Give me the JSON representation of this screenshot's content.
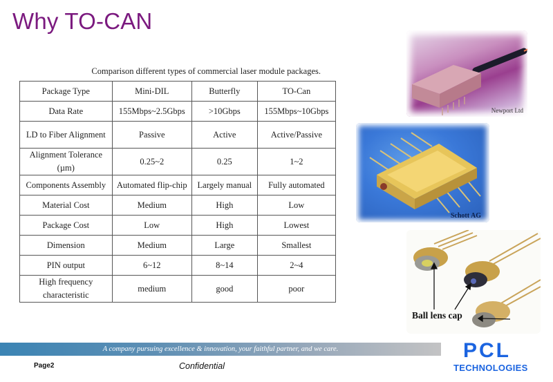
{
  "slide": {
    "title": "Why TO-CAN",
    "caption": "Comparison different types of commercial laser module packages."
  },
  "table": {
    "columns": [
      "Package Type",
      "Mini-DIL",
      "Butterfly",
      "TO-Can"
    ],
    "rows": [
      [
        "Data Rate",
        "155Mbps~2.5Gbps",
        ">10Gbps",
        "155Mbps~10Gbps"
      ],
      [
        "LD to Fiber Alignment",
        "Passive",
        "Active",
        "Active/Passive"
      ],
      [
        "Alignment Tolerance (µm)",
        "0.25~2",
        "0.25",
        "1~2"
      ],
      [
        "Components Assembly",
        "Automated flip-chip",
        "Largely manual",
        "Fully automated"
      ],
      [
        "Material Cost",
        "Medium",
        "High",
        "Low"
      ],
      [
        "Package Cost",
        "Low",
        "High",
        "Lowest"
      ],
      [
        "Dimension",
        "Medium",
        "Large",
        "Smallest"
      ],
      [
        "PIN output",
        "6~12",
        "8~14",
        "2~4"
      ],
      [
        "High frequency characteristic",
        "medium",
        "good",
        "poor"
      ]
    ]
  },
  "photos": [
    {
      "subject": "mini-dil-module",
      "credit": "Newport Ltd"
    },
    {
      "subject": "butterfly-package",
      "credit": "Schott AG"
    },
    {
      "subject": "to-can-packages",
      "annotation": "Ball lens cap"
    }
  ],
  "footer": {
    "tagline": "A company pursuing excellence  & innovation, your faithful partner, and we care.",
    "page": "Page2",
    "confidential": "Confidential",
    "logo_mark": "PCL",
    "logo_text": "TECHNOLOGIES",
    "brand_color": "#1b64e0",
    "title_color": "#7b1a7f"
  }
}
